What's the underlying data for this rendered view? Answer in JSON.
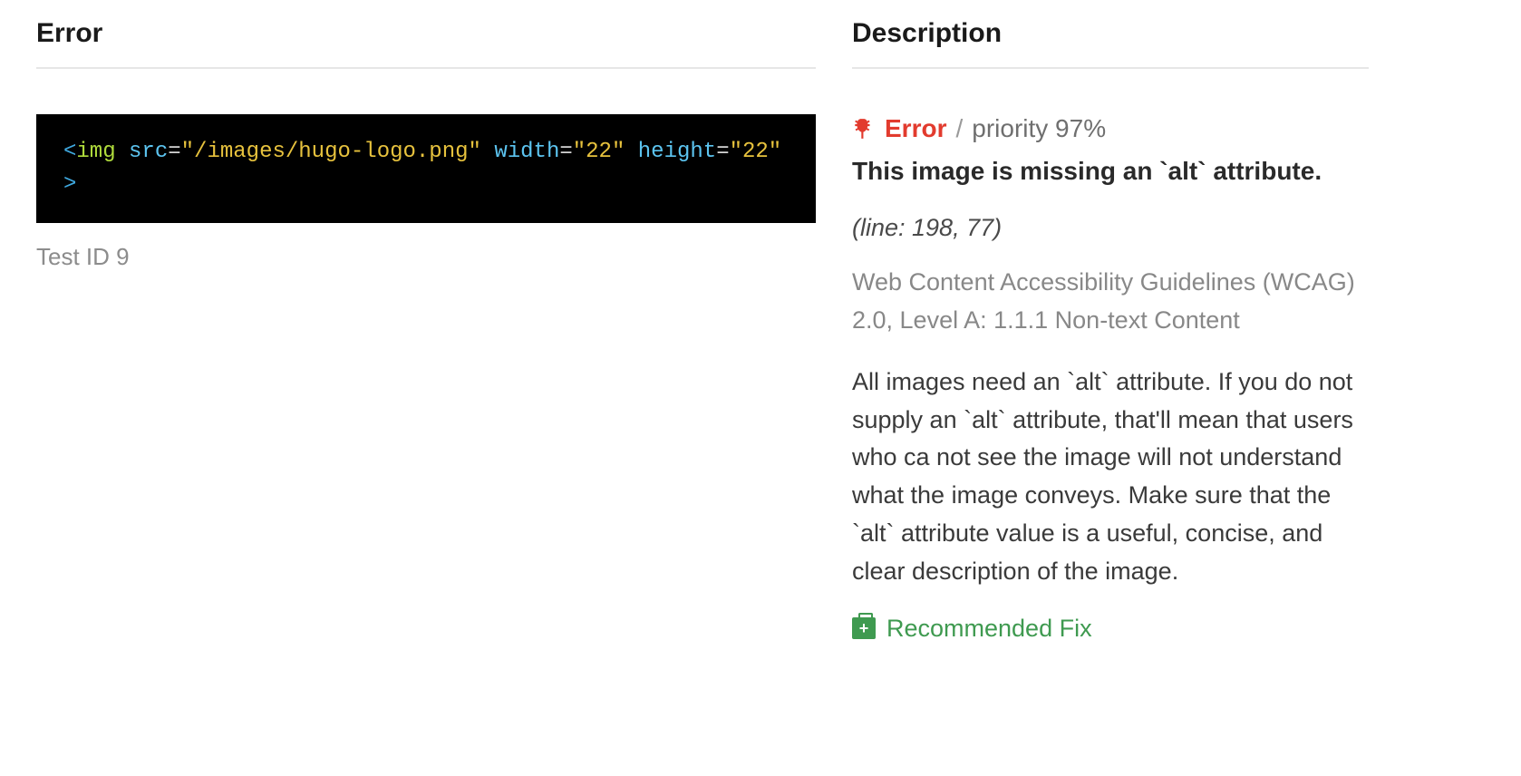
{
  "headers": {
    "left": "Error",
    "right": "Description"
  },
  "code": {
    "t1": "<",
    "t2": "img",
    "sp1": " ",
    "t3": "src",
    "t4": "=",
    "t5": "\"/images/hugo-logo.png\"",
    "sp2": " ",
    "t6": "width",
    "t7": "=",
    "t8": "\"22\"",
    "sp3": " ",
    "t9": "height",
    "t10": "=",
    "t11": "\"22\"",
    "t12": " >"
  },
  "test_id": "Test ID 9",
  "status": {
    "label": "Error",
    "separator": "/",
    "priority": "priority 97%"
  },
  "error_title": "This image is missing an `alt` attribute.",
  "line_info": "(line: 198, 77)",
  "wcag": "Web Content Accessibility Guidelines (WCAG) 2.0, Level A: 1.1.1 Non-text Content",
  "explanation": "All images need an `alt` attribute. If you do not supply an `alt` attribute, that'll mean that users who ca not see the image will not understand what the image conveys. Make sure that the `alt` attribute value is a useful, concise, and clear description of the image.",
  "fix_label": "Recommended Fix"
}
